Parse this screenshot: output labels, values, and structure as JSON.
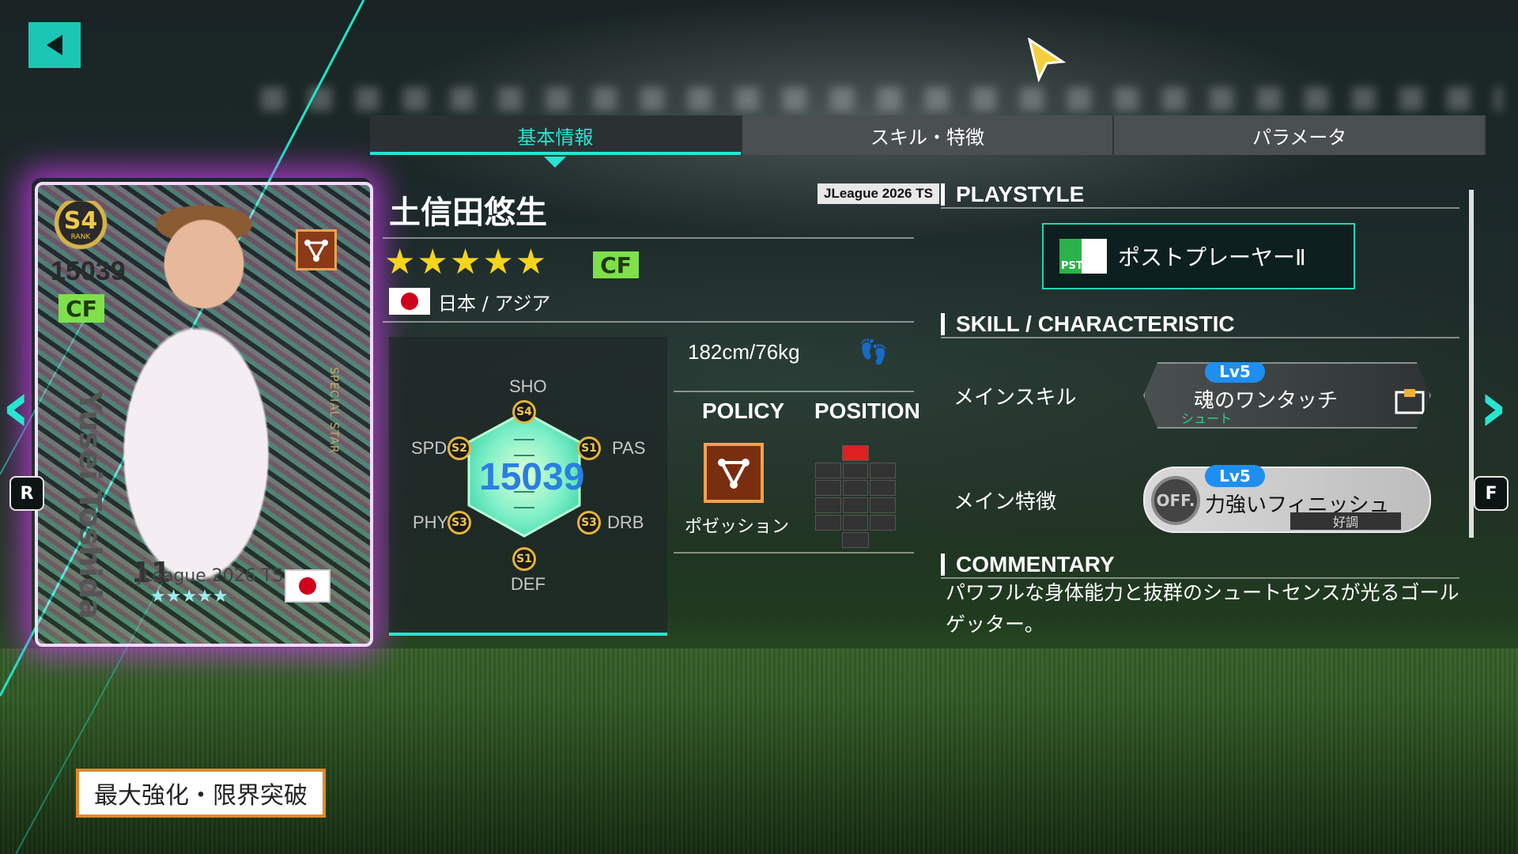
{
  "tabs": [
    {
      "label": "基本情報",
      "active": true
    },
    {
      "label": "スキル・特徴",
      "active": false
    },
    {
      "label": "パラメータ",
      "active": false
    }
  ],
  "card": {
    "rank": "S4",
    "rank_label": "RANK",
    "rating": "15039",
    "position": "CF",
    "name_vertical": "Yusei Toshida",
    "special_label": "SPECIAL STAR",
    "number": "11",
    "league": "JLeague 2026 TS",
    "stars": "★★★★★"
  },
  "side_buttons": {
    "left": "R",
    "right": "F"
  },
  "enhance_button": "最大強化・限界突破",
  "player": {
    "name": "土信田悠生",
    "league_tag": "JLeague 2026 TS",
    "stars": "★★★★★",
    "position": "CF",
    "nation": "日本 / アジア",
    "body": "182cm/76kg"
  },
  "stats": {
    "overall": "15039",
    "items": [
      {
        "label": "SHO",
        "grade": "S4"
      },
      {
        "label": "PAS",
        "grade": "S1"
      },
      {
        "label": "DRB",
        "grade": "S3"
      },
      {
        "label": "DEF",
        "grade": "S1"
      },
      {
        "label": "PHY",
        "grade": "S3"
      },
      {
        "label": "SPD",
        "grade": "S2"
      }
    ]
  },
  "policy": {
    "title": "POLICY",
    "name": "ポゼッション"
  },
  "position_map": {
    "title": "POSITION"
  },
  "playstyle": {
    "title": "PLAYSTYLE",
    "icon_text": "PST",
    "name": "ポストプレーヤーⅡ"
  },
  "skills": {
    "title": "SKILL / CHARACTERISTIC",
    "main_skill_label": "メインスキル",
    "main_skill": {
      "level": "Lv5",
      "name": "魂のワンタッチ",
      "type": "シュート"
    },
    "main_char_label": "メイン特徴",
    "main_char": {
      "level": "Lv5",
      "name": "力強いフィニッシュ",
      "badge": "OFF.",
      "condition": "好調"
    }
  },
  "commentary": {
    "title": "COMMENTARY",
    "text": "パワフルな身体能力と抜群のシュートセンスが光るゴールゲッター。"
  },
  "colors": {
    "accent": "#27e5d0",
    "grade_gold": "#e3b43d",
    "position_green": "#7ee04a",
    "star_yellow": "#f5d51b"
  }
}
